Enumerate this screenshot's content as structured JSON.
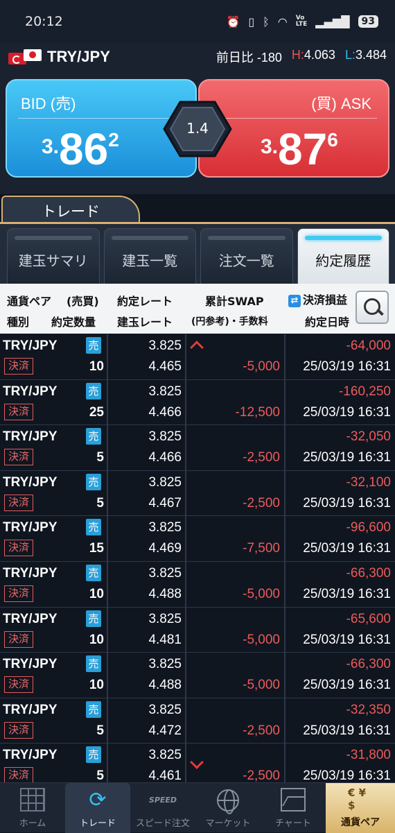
{
  "status_bar": {
    "time": "20:12",
    "volte_top": "Vo",
    "volte_bottom": "LTE",
    "battery": "93"
  },
  "pair_header": {
    "pair": "TRY/JPY",
    "change_label": "前日比 -180",
    "high_label": "H:",
    "high_value": "4.063",
    "low_label": "L:",
    "low_value": "3.484"
  },
  "quote": {
    "bid_label": "BID (売)",
    "ask_label": "(買) ASK",
    "bid_big": "3.",
    "bid_mid": "86",
    "bid_small": "2",
    "ask_big": "3.",
    "ask_mid": "87",
    "ask_small": "6",
    "spread": "1.4"
  },
  "tabs": {
    "trade": "トレード",
    "sub": [
      "建玉サマリ",
      "建玉一覧",
      "注文一覧",
      "約定履歴"
    ],
    "active_index": 3
  },
  "columns": {
    "pair": "通貨ペア",
    "side": "(売買)",
    "kind": "種別",
    "qty": "約定数量",
    "rate": "約定レート",
    "open_rate": "建玉レート",
    "swap": "累計SWAP",
    "swap_sub": "(円参考)・手数料",
    "pl": "決済損益",
    "date": "約定日時"
  },
  "rows": [
    {
      "pair": "TRY/JPY",
      "side": "売",
      "kind": "決済",
      "qty": "10",
      "rate": "3.825",
      "open_rate": "4.465",
      "fee": "-5,000",
      "pl": "-64,000",
      "date": "25/03/19 16:31"
    },
    {
      "pair": "TRY/JPY",
      "side": "売",
      "kind": "決済",
      "qty": "25",
      "rate": "3.825",
      "open_rate": "4.466",
      "fee": "-12,500",
      "pl": "-160,250",
      "date": "25/03/19 16:31"
    },
    {
      "pair": "TRY/JPY",
      "side": "売",
      "kind": "決済",
      "qty": "5",
      "rate": "3.825",
      "open_rate": "4.466",
      "fee": "-2,500",
      "pl": "-32,050",
      "date": "25/03/19 16:31"
    },
    {
      "pair": "TRY/JPY",
      "side": "売",
      "kind": "決済",
      "qty": "5",
      "rate": "3.825",
      "open_rate": "4.467",
      "fee": "-2,500",
      "pl": "-32,100",
      "date": "25/03/19 16:31"
    },
    {
      "pair": "TRY/JPY",
      "side": "売",
      "kind": "決済",
      "qty": "15",
      "rate": "3.825",
      "open_rate": "4.469",
      "fee": "-7,500",
      "pl": "-96,600",
      "date": "25/03/19 16:31"
    },
    {
      "pair": "TRY/JPY",
      "side": "売",
      "kind": "決済",
      "qty": "10",
      "rate": "3.825",
      "open_rate": "4.488",
      "fee": "-5,000",
      "pl": "-66,300",
      "date": "25/03/19 16:31"
    },
    {
      "pair": "TRY/JPY",
      "side": "売",
      "kind": "決済",
      "qty": "10",
      "rate": "3.825",
      "open_rate": "4.481",
      "fee": "-5,000",
      "pl": "-65,600",
      "date": "25/03/19 16:31"
    },
    {
      "pair": "TRY/JPY",
      "side": "売",
      "kind": "決済",
      "qty": "10",
      "rate": "3.825",
      "open_rate": "4.488",
      "fee": "-5,000",
      "pl": "-66,300",
      "date": "25/03/19 16:31"
    },
    {
      "pair": "TRY/JPY",
      "side": "売",
      "kind": "決済",
      "qty": "5",
      "rate": "3.825",
      "open_rate": "4.472",
      "fee": "-2,500",
      "pl": "-32,350",
      "date": "25/03/19 16:31"
    },
    {
      "pair": "TRY/JPY",
      "side": "売",
      "kind": "決済",
      "qty": "5",
      "rate": "3.825",
      "open_rate": "4.461",
      "fee": "-2,500",
      "pl": "-31,800",
      "date": "25/03/19 16:31"
    }
  ],
  "bottom_nav": [
    {
      "label": "ホーム",
      "icon": "home-grid-icon"
    },
    {
      "label": "トレード",
      "icon": "refresh-icon"
    },
    {
      "label": "スピード注文",
      "icon": "speed-icon",
      "icon_text": "SPEED"
    },
    {
      "label": "マーケット",
      "icon": "globe-icon"
    },
    {
      "label": "チャート",
      "icon": "chart-icon"
    },
    {
      "label": "通貨ペア",
      "icon": "currency-pair-icon",
      "icon_text": "€ ¥ $"
    }
  ],
  "colors": {
    "bid": "#1b8fd9",
    "ask": "#d82f35",
    "negative": "#ee5a5a",
    "accent_gold": "#d8b070",
    "active_tab_glow": "#3fcaf2"
  }
}
